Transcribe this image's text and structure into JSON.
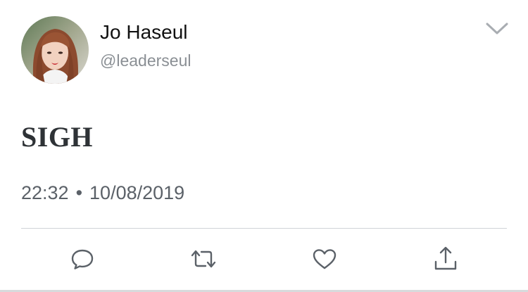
{
  "tweet": {
    "display_name": "Jo Haseul",
    "handle": "@leaderseul",
    "text": "SIGH",
    "time": "22:32",
    "separator": "•",
    "date": "10/08/2019"
  },
  "actions": {
    "reply": "reply-icon",
    "retweet": "retweet-icon",
    "like": "heart-icon",
    "share": "share-icon"
  },
  "colors": {
    "name": "#111111",
    "handle": "#8a8f94",
    "tweet_text": "#2e3236",
    "timestamp": "#5b6168",
    "icon": "#5b6168",
    "divider": "#cfd3d7"
  }
}
